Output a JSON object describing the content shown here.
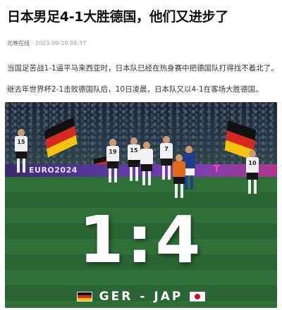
{
  "article": {
    "title": "日本男足4-1大胜德国，他们又进步了",
    "source": "北晚在线",
    "datetime": "2023-09-10 08:37",
    "paragraphs": [
      "当国足苦战1-1逼平马来西亚时，日本队已经在热身赛中把德国队打得找不着北了。",
      "继去年世界杯2-1击败德国队后，10日凌晨，日本队又以4-1在客场大胜德国。"
    ]
  },
  "photo": {
    "board_text": "EURO2024",
    "board_logo": "T",
    "score": "1:4",
    "team_home": "GER",
    "separator": "-",
    "team_away": "JAP",
    "player_numbers": [
      "15",
      "19",
      "15",
      "7",
      "10"
    ],
    "colors": {
      "germany_black": "#111111",
      "germany_red": "#d9281f",
      "germany_gold": "#f3c30d",
      "japan_red": "#c8102e"
    }
  }
}
